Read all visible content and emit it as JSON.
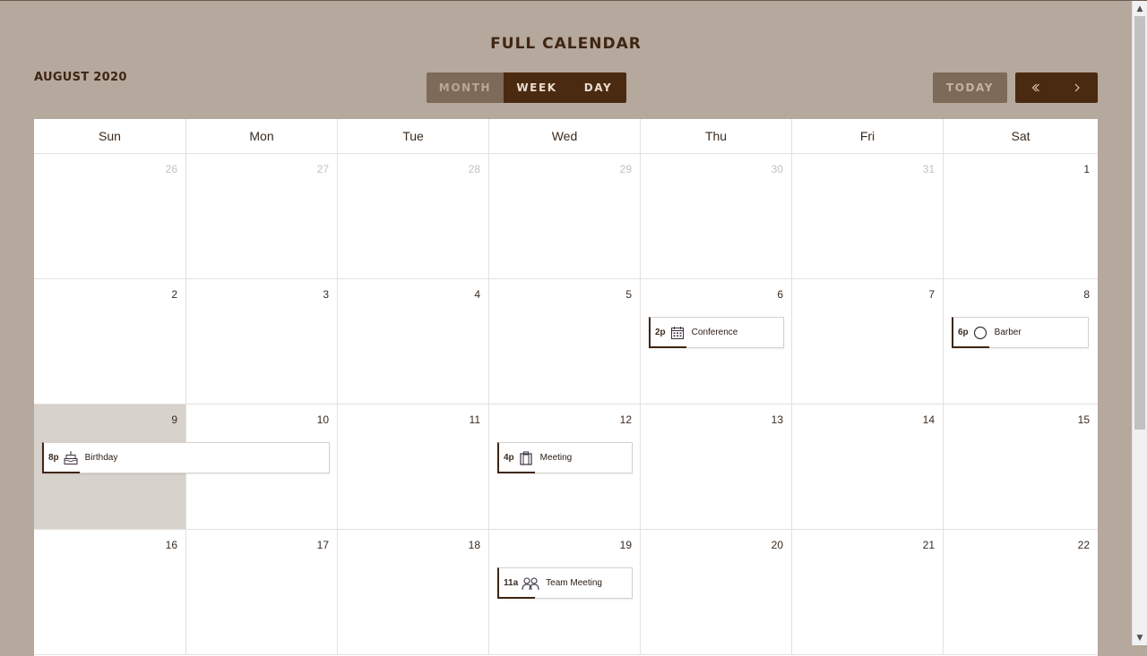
{
  "header": {
    "title": "FULL CALENDAR",
    "month_label": "AUGUST 2020"
  },
  "views": [
    {
      "label": "MONTH",
      "active": true
    },
    {
      "label": "WEEK",
      "active": false
    },
    {
      "label": "DAY",
      "active": false
    }
  ],
  "nav": {
    "today_label": "TODAY",
    "prev_icon": "chevron-left-icon",
    "next_icon": "chevron-right-icon"
  },
  "weekdays": [
    "Sun",
    "Mon",
    "Tue",
    "Wed",
    "Thu",
    "Fri",
    "Sat"
  ],
  "weeks": [
    [
      {
        "n": "26",
        "other": true
      },
      {
        "n": "27",
        "other": true
      },
      {
        "n": "28",
        "other": true
      },
      {
        "n": "29",
        "other": true
      },
      {
        "n": "30",
        "other": true
      },
      {
        "n": "31",
        "other": true
      },
      {
        "n": "1"
      }
    ],
    [
      {
        "n": "2"
      },
      {
        "n": "3"
      },
      {
        "n": "4"
      },
      {
        "n": "5"
      },
      {
        "n": "6"
      },
      {
        "n": "7"
      },
      {
        "n": "8"
      }
    ],
    [
      {
        "n": "9",
        "today": true
      },
      {
        "n": "10"
      },
      {
        "n": "11"
      },
      {
        "n": "12"
      },
      {
        "n": "13"
      },
      {
        "n": "14"
      },
      {
        "n": "15"
      }
    ],
    [
      {
        "n": "16"
      },
      {
        "n": "17"
      },
      {
        "n": "18"
      },
      {
        "n": "19"
      },
      {
        "n": "20"
      },
      {
        "n": "21"
      },
      {
        "n": "22"
      }
    ]
  ],
  "events": {
    "conference": {
      "time": "2p",
      "title": "Conference",
      "icon": "calendar-icon"
    },
    "barber": {
      "time": "6p",
      "title": "Barber",
      "icon": "circle-icon"
    },
    "birthday": {
      "time": "8p",
      "title": "Birthday",
      "icon": "cake-icon"
    },
    "meeting": {
      "time": "4p",
      "title": "Meeting",
      "icon": "clipboard-icon"
    },
    "team_meeting": {
      "time": "11a",
      "title": "Team Meeting",
      "icon": "people-icon"
    }
  },
  "colors": {
    "background": "#b5a89c",
    "primary": "#4a2a10",
    "muted_button": "#7e6a58",
    "today_cell": "#d8d2cd"
  }
}
